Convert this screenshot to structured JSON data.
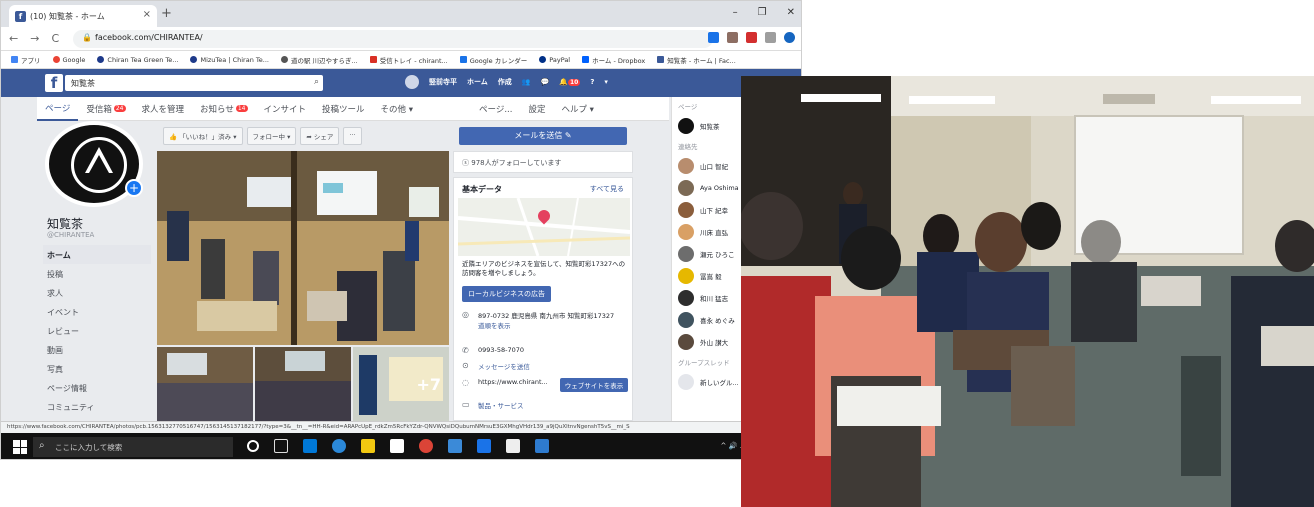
{
  "browser": {
    "tab_title": "(10) 知覧茶 - ホーム",
    "tab_close": "×",
    "new_tab": "+",
    "url": "facebook.com/CHIRANTEA/",
    "window_controls": [
      "–",
      "❐",
      "✕"
    ],
    "bookmarks": [
      "アプリ",
      "Google",
      "Chiran Tea Green Te...",
      "MizuTea | Chiran Te...",
      "道の駅 川辺やすらぎ...",
      "受信トレイ - chirant...",
      "Google カレンダー",
      "PayPal",
      "ホーム - Dropbox",
      "知覧茶 - ホーム | Fac..."
    ]
  },
  "facebook": {
    "logo": "f",
    "search_value": "知覧茶",
    "top_links": [
      "竪前寺平",
      "ホーム",
      "作成"
    ],
    "notif_badge": "10",
    "page_nav": [
      {
        "label": "ページ",
        "badge": ""
      },
      {
        "label": "受信箱",
        "badge": "24"
      },
      {
        "label": "求人を管理",
        "badge": ""
      },
      {
        "label": "お知らせ",
        "badge": "14"
      },
      {
        "label": "インサイト",
        "badge": ""
      },
      {
        "label": "投稿ツール",
        "badge": ""
      },
      {
        "label": "その他 ▾",
        "badge": ""
      },
      {
        "label": "ページ...",
        "badge": ""
      },
      {
        "label": "設定",
        "badge": ""
      },
      {
        "label": "ヘルプ ▾",
        "badge": ""
      }
    ],
    "page_name": "知覧茶",
    "page_handle": "@CHIRANTEA",
    "left_menu": [
      "ホーム",
      "投稿",
      "求人",
      "イベント",
      "レビュー",
      "動画",
      "写真",
      "ページ情報",
      "コミュニティ",
      "グループ"
    ],
    "actions": [
      "👍 「いいね！」済み ▾",
      "フォロー中 ▾",
      "➦ シェア",
      "···"
    ],
    "more_photos": "+7",
    "message_button": "メールを送信 ✎",
    "followers_text": "978人がフォローしています",
    "basic_data": {
      "heading": "基本データ",
      "see_all": "すべて見る",
      "desc": "近隣エリアのビジネスを宣伝して、知覧町彩17327への訪問客を増やしましょう。",
      "promote_button": "ローカルビジネスの広告",
      "address": "897-0732 鹿児島県 南九州市 知覧町彩17327",
      "directions": "道順を表示",
      "phone": "0993-58-7070",
      "message": "メッセージを送信",
      "website": "https://www.chirant...",
      "website_button": "ウェブサイトを表示",
      "category": "製品・サービス"
    },
    "right_sidebar": {
      "heading_pages": "ページ",
      "page_item": "知覧茶",
      "heading_contacts": "連絡先",
      "contacts": [
        "山口 智紀",
        "Aya Oshima",
        "山下 紀幸",
        "川床 直弘",
        "瀬元 ひろこ",
        "冨嶌 毅",
        "和川 猛志",
        "喜永 めぐみ",
        "外山 讃大"
      ],
      "heading_groups": "グループスレッド",
      "group_item": "新しいグル..."
    }
  },
  "statusbar": "https://www.facebook.com/CHIRANTEA/photos/pcb.1563132770516747/1563145137182177/?type=3&__tn__=HH-R&eid=ARAPcUpE_rdkZm5RcFkYZdr-QNVWQsiDQubumNMrsuE3GXMhgVHdr139_a9jQuXltnvNgenshT5vS__mi_S",
  "taskbar": {
    "search_placeholder": "ここに入力して検索",
    "tray": "^ 🔊 ☁ 🖫 🔉 👤 ⓘ 20"
  },
  "colors": {
    "facebook_blue": "#3b5998",
    "button_blue": "#4267b2",
    "badge_red": "#fa3e3e"
  }
}
